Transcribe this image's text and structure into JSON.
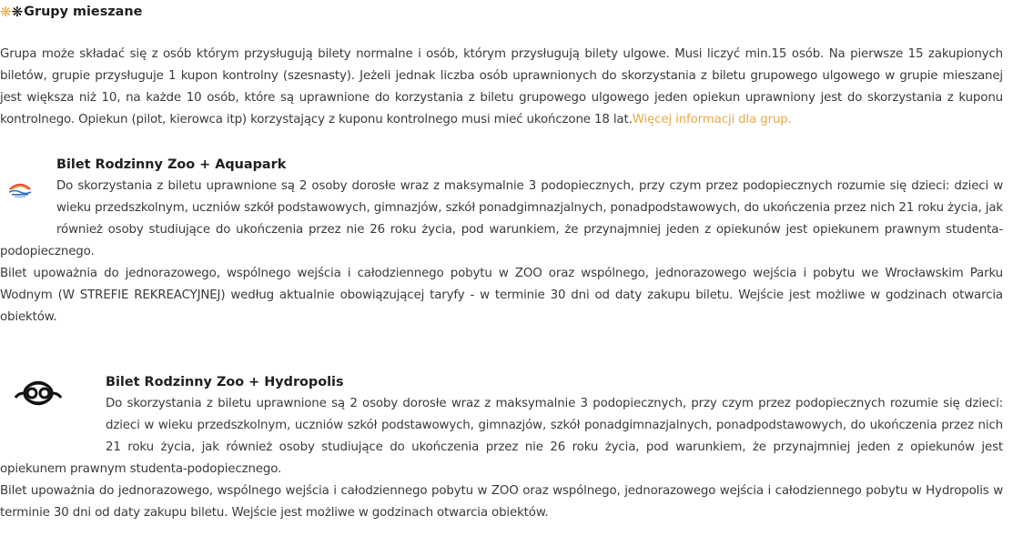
{
  "heading": {
    "text": "Grupy mieszane",
    "icon_colors": [
      "#f0a848",
      "#111111"
    ]
  },
  "group_paragraph": {
    "text": "Grupa może składać się z osób którym przysługują bilety normalne i osób, którym przysługują bilety ulgowe. Musi liczyć min.15 osób. Na pierwsze  15 zakupionych biletów, grupie przysługuje 1  kupon kontrolny (szesnasty). Jeżeli jednak liczba osób uprawnionych do skorzystania z biletu grupowego ulgowego w grupie mieszanej jest większa niż 10, na każde 10 osób, które są uprawnione do korzystania z biletu grupowego ulgowego jeden opiekun  uprawniony jest do skorzystania z kuponu kontrolnego. Opiekun (pilot, kierowca itp) korzystający z  kuponu kontrolnego musi mieć ukończone 18 lat.",
    "link_text": "Więcej informacji dla grup.",
    "link_color": "#f0a848"
  },
  "aquapark": {
    "logo_icon": "aquapark-logo-icon",
    "title": "Bilet Rodzinny Zoo + Aquapark",
    "eligibility": "Do skorzystania z biletu uprawnione są 2 osoby dorosłe wraz z maksymalnie 3 podopiecznych, przy czym przez podopiecznych rozumie się dzieci: dzieci w wieku przedszkolnym, uczniów szkół podstawowych, gimnazjów, szkół ponadgimnazjalnych, ponadpodstawowych, do ukończenia przez nich 21 roku życia, jak również osoby studiujące do ukończenia przez nie 26 roku życia, pod warunkiem, że przynajmniej jeden z opiekunów jest opiekunem prawnym studenta-podopiecznego.",
    "validity": "Bilet upoważnia do jednorazowego, wspólnego wejścia  i całodziennego pobytu w ZOO oraz wspólnego, jednorazowego wejścia i pobytu we Wrocławskim Parku Wodnym (W STREFIE REKREACYJNEJ) według aktualnie obowiązującej taryfy - w terminie 30 dni od daty zakupu biletu. Wejście jest możliwe w godzinach otwarcia obiektów."
  },
  "hydropolis": {
    "logo_icon": "hydropolis-logo-icon",
    "title": "Bilet Rodzinny Zoo + Hydropolis",
    "eligibility": "Do skorzystania z biletu uprawnione są 2 osoby dorosłe wraz z maksymalnie 3 podopiecznych, przy czym przez podopiecznych rozumie się dzieci: dzieci w wieku przedszkolnym, uczniów szkół podstawowych, gimnazjów, szkół ponadgimnazjalnych, ponadpodstawowych, do ukończenia przez nich 21 roku życia, jak również osoby studiujące do ukończenia przez nie 26 roku życia, pod warunkiem, że przynajmniej jeden z opiekunów jest opiekunem prawnym studenta-podopiecznego.",
    "validity": "Bilet upoważnia do jednorazowego, wspólnego wejścia  i całodziennego pobytu w ZOO oraz wspólnego, jednorazowego wejścia i całodziennego pobytu w Hydropolis w terminie 30 dni od daty zakupu biletu. Wejście jest możliwe w godzinach otwarcia obiektów."
  }
}
